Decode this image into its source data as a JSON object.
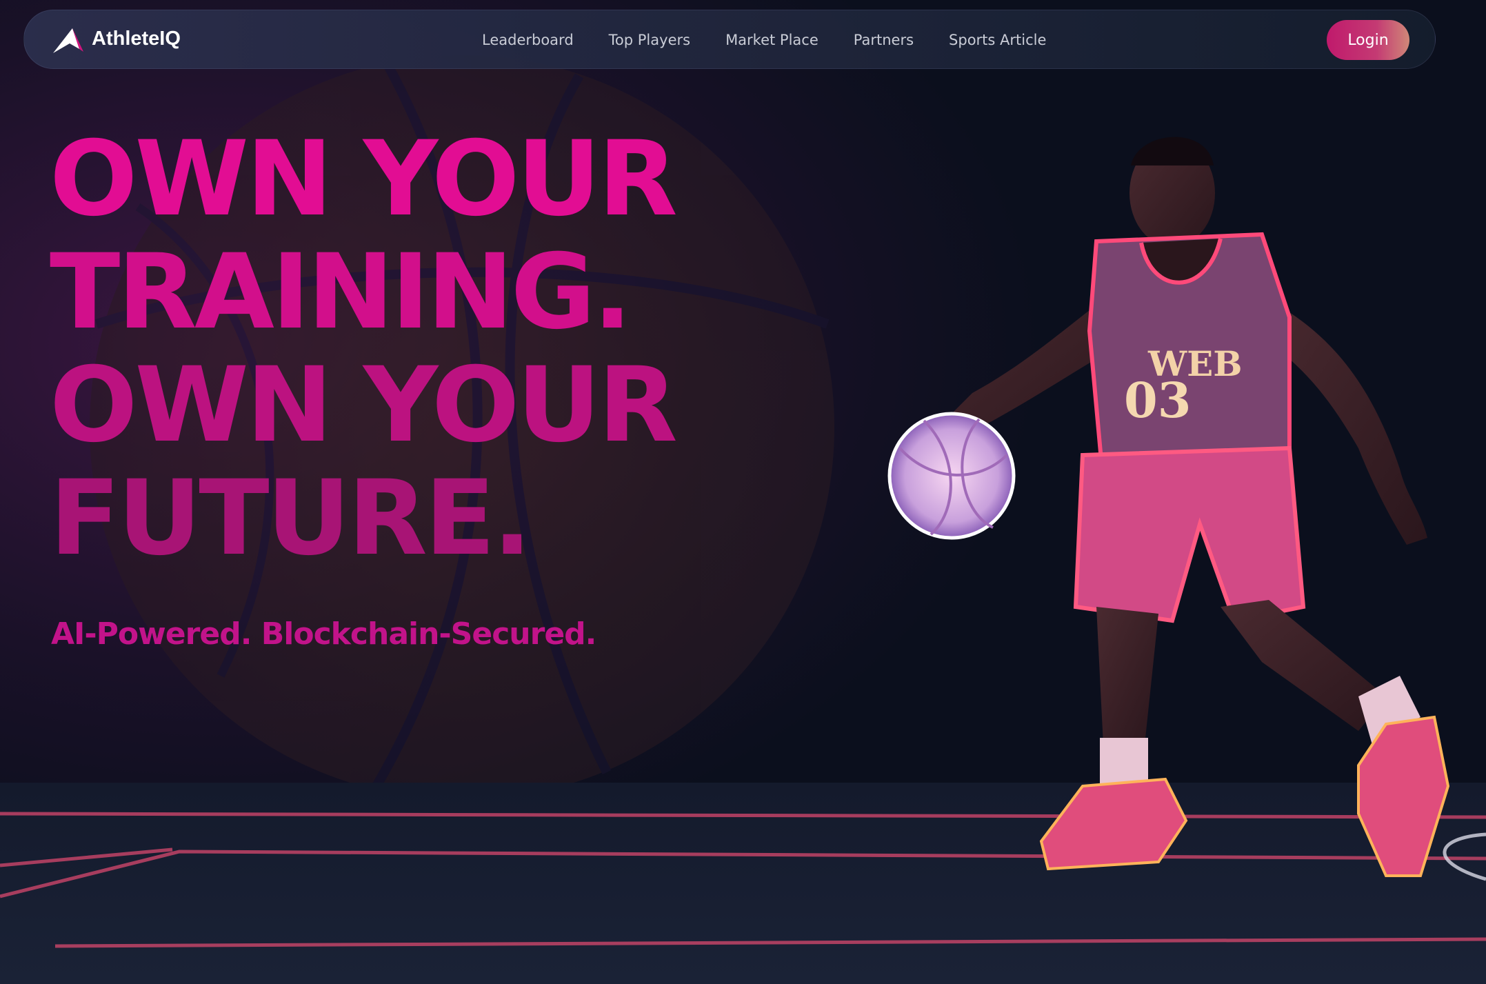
{
  "brand": {
    "name": "AthleteIQ",
    "logo_icon": "athleteiq-logo-icon"
  },
  "nav": {
    "items": [
      {
        "label": "Leaderboard"
      },
      {
        "label": "Top Players"
      },
      {
        "label": "Market Place"
      },
      {
        "label": "Partners"
      },
      {
        "label": "Sports Article"
      }
    ],
    "login_label": "Login"
  },
  "hero": {
    "headline_lines": [
      "OWN YOUR",
      "TRAINING.",
      "OWN YOUR",
      "FUTURE."
    ],
    "tagline": "AI-Powered. Blockchain-Secured.",
    "jersey": {
      "team": "WEB",
      "number": "03"
    }
  },
  "colors": {
    "accent": "#e20d93",
    "background": "#0b0f1d",
    "login_gradient_start": "#c01a6c",
    "login_gradient_end": "#d08878"
  }
}
